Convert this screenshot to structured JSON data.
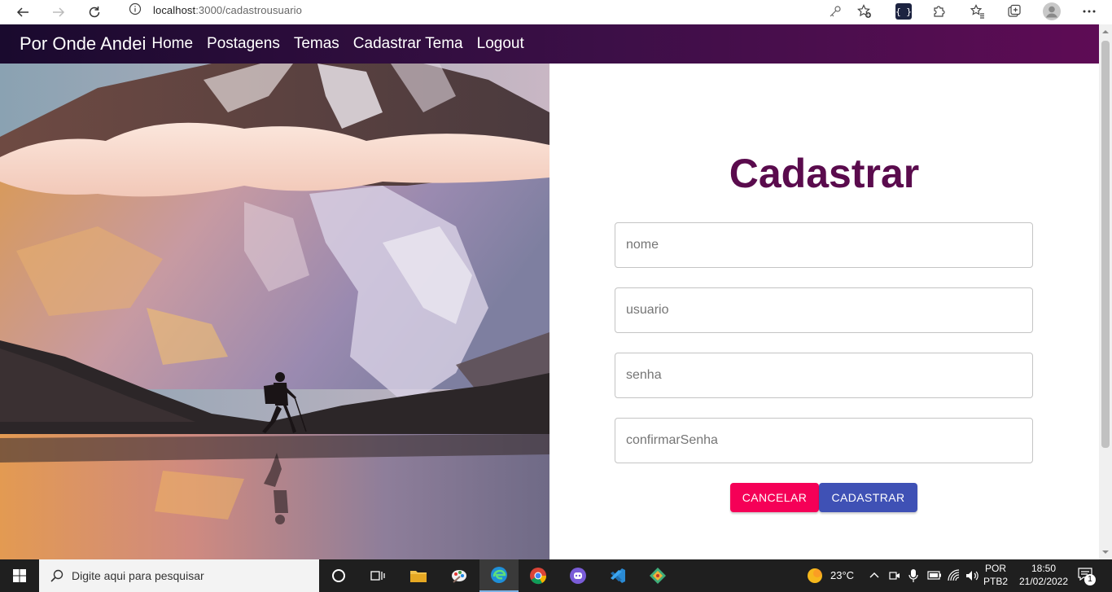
{
  "browser": {
    "url_host": "localhost",
    "url_path": ":3000/cadastrousuario"
  },
  "navbar": {
    "brand": "Por Onde Andei",
    "links": [
      "Home",
      "Postagens",
      "Temas",
      "Cadastrar Tema",
      "Logout"
    ]
  },
  "form": {
    "title": "Cadastrar",
    "fields": {
      "nome": "nome",
      "usuario": "usuario",
      "senha": "senha",
      "confirmar": "confirmarSenha"
    },
    "cancel_label": "CANCELAR",
    "submit_label": "CADASTRAR",
    "colors": {
      "title": "#5a0b4d",
      "cancel": "#f50057",
      "submit": "#3f51b5"
    }
  },
  "taskbar": {
    "search_placeholder": "Digite aqui para pesquisar",
    "weather": "23°C",
    "lang_top": "POR",
    "lang_bottom": "PTB2",
    "time": "18:50",
    "date": "21/02/2022",
    "notification_count": "1"
  }
}
